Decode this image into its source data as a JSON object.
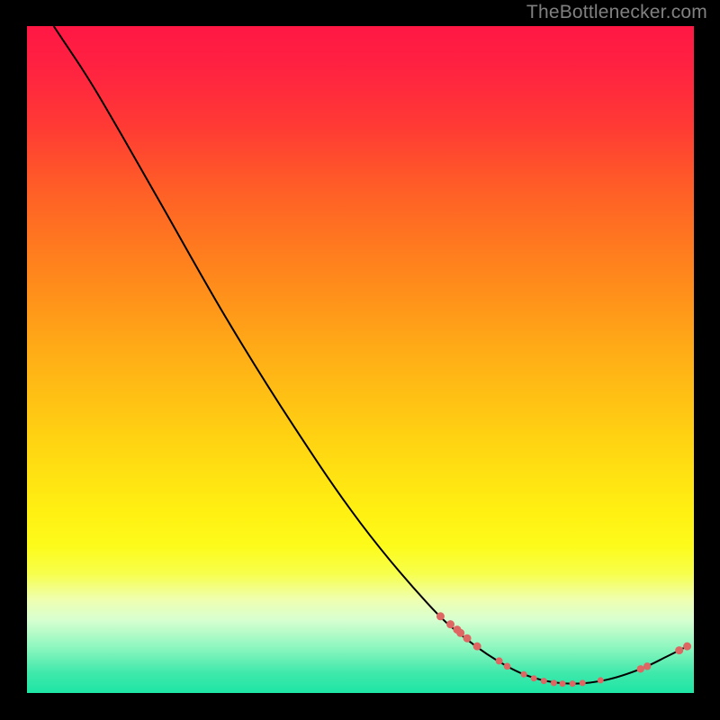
{
  "watermark": "TheBottlenecker.com",
  "chart_data": {
    "type": "line",
    "title": "",
    "xlabel": "",
    "ylabel": "",
    "xlim": [
      0,
      100
    ],
    "ylim": [
      0,
      100
    ],
    "grid": false,
    "background_gradient": {
      "stops": [
        {
          "offset": 0.0,
          "color": "#ff1744"
        },
        {
          "offset": 0.07,
          "color": "#ff2440"
        },
        {
          "offset": 0.15,
          "color": "#ff3a34"
        },
        {
          "offset": 0.25,
          "color": "#ff6026"
        },
        {
          "offset": 0.37,
          "color": "#ff861c"
        },
        {
          "offset": 0.5,
          "color": "#ffb016"
        },
        {
          "offset": 0.62,
          "color": "#ffd312"
        },
        {
          "offset": 0.73,
          "color": "#fff112"
        },
        {
          "offset": 0.78,
          "color": "#fdfb1b"
        },
        {
          "offset": 0.82,
          "color": "#f7ff4a"
        },
        {
          "offset": 0.86,
          "color": "#efffb0"
        },
        {
          "offset": 0.89,
          "color": "#d8ffd0"
        },
        {
          "offset": 0.93,
          "color": "#90f7c0"
        },
        {
          "offset": 0.97,
          "color": "#3fe8ab"
        },
        {
          "offset": 1.0,
          "color": "#1ee6a5"
        }
      ]
    },
    "series": [
      {
        "name": "curve",
        "stroke": "#000000",
        "type": "line",
        "points": [
          {
            "x": 4.0,
            "y": 100.0
          },
          {
            "x": 5.0,
            "y": 98.5
          },
          {
            "x": 6.0,
            "y": 97.0
          },
          {
            "x": 8.0,
            "y": 94.0
          },
          {
            "x": 10.5,
            "y": 90.0
          },
          {
            "x": 14.0,
            "y": 84.0
          },
          {
            "x": 20.0,
            "y": 73.5
          },
          {
            "x": 30.0,
            "y": 56.0
          },
          {
            "x": 40.0,
            "y": 40.0
          },
          {
            "x": 50.0,
            "y": 25.5
          },
          {
            "x": 60.0,
            "y": 13.5
          },
          {
            "x": 66.0,
            "y": 8.0
          },
          {
            "x": 72.0,
            "y": 4.0
          },
          {
            "x": 77.0,
            "y": 2.0
          },
          {
            "x": 82.0,
            "y": 1.4
          },
          {
            "x": 87.0,
            "y": 2.0
          },
          {
            "x": 92.0,
            "y": 3.6
          },
          {
            "x": 96.0,
            "y": 5.5
          },
          {
            "x": 99.0,
            "y": 7.0
          }
        ]
      },
      {
        "name": "markers-upper",
        "stroke": "#de6764",
        "fill": "#de6764",
        "type": "scatter",
        "points": [
          {
            "x": 62.0,
            "y": 11.5,
            "r": 4.5
          },
          {
            "x": 63.5,
            "y": 10.3,
            "r": 4.5
          },
          {
            "x": 64.5,
            "y": 9.5,
            "r": 4.5
          },
          {
            "x": 65.0,
            "y": 9.0,
            "r": 4.5
          },
          {
            "x": 66.0,
            "y": 8.2,
            "r": 4.5
          },
          {
            "x": 67.5,
            "y": 7.0,
            "r": 4.5
          },
          {
            "x": 70.8,
            "y": 4.8,
            "r": 4.0
          },
          {
            "x": 72.0,
            "y": 4.0,
            "r": 3.8
          }
        ]
      },
      {
        "name": "markers-valley",
        "stroke": "#de6764",
        "fill": "#de6764",
        "type": "scatter",
        "points": [
          {
            "x": 74.5,
            "y": 2.8,
            "r": 3.5
          },
          {
            "x": 76.0,
            "y": 2.2,
            "r": 3.5
          },
          {
            "x": 77.5,
            "y": 1.8,
            "r": 3.5
          },
          {
            "x": 79.0,
            "y": 1.5,
            "r": 3.5
          },
          {
            "x": 80.3,
            "y": 1.4,
            "r": 3.5
          },
          {
            "x": 81.8,
            "y": 1.4,
            "r": 3.5
          },
          {
            "x": 83.3,
            "y": 1.5,
            "r": 3.5
          },
          {
            "x": 86.0,
            "y": 1.9,
            "r": 3.5
          }
        ]
      },
      {
        "name": "markers-right",
        "stroke": "#de6764",
        "fill": "#de6764",
        "type": "scatter",
        "points": [
          {
            "x": 92.0,
            "y": 3.6,
            "r": 4.2
          },
          {
            "x": 93.0,
            "y": 4.0,
            "r": 4.2
          },
          {
            "x": 97.8,
            "y": 6.4,
            "r": 4.5
          },
          {
            "x": 99.0,
            "y": 7.0,
            "r": 4.5
          }
        ]
      }
    ]
  }
}
